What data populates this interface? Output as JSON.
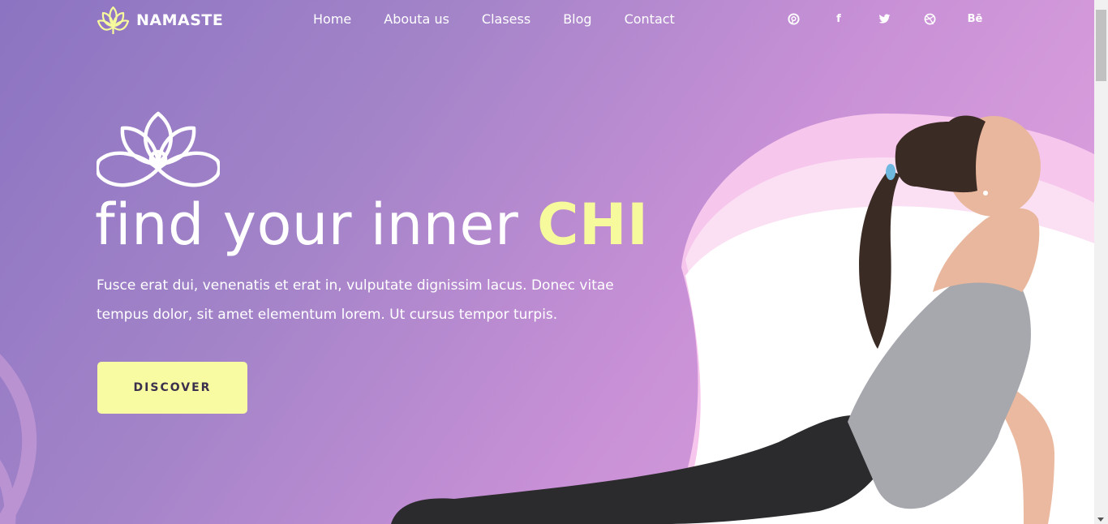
{
  "brand": {
    "name": "NAMASTE"
  },
  "nav": {
    "items": [
      {
        "label": "Home"
      },
      {
        "label": "Abouta us"
      },
      {
        "label": "Clasess"
      },
      {
        "label": "Blog"
      },
      {
        "label": "Contact"
      }
    ]
  },
  "social": {
    "pinterest": "pinterest-icon",
    "facebook": "f",
    "twitter": "twitter-icon",
    "dribbble": "dribbble-icon",
    "behance": "Bē"
  },
  "hero": {
    "headline_main": "find your inner ",
    "headline_accent": "CHI",
    "description": "Fusce erat dui, venenatis et erat in, vulputate dignissim lacus. Donec vitae tempus dolor, sit amet elementum lorem. Ut cursus tempor turpis.",
    "cta_label": "DISCOVER"
  },
  "colors": {
    "accent": "#f7fa9c",
    "button_bg": "#f8fba1",
    "button_text": "#3a2f4d",
    "bg_start": "#8c74c2",
    "bg_end": "#e3a6e0"
  }
}
